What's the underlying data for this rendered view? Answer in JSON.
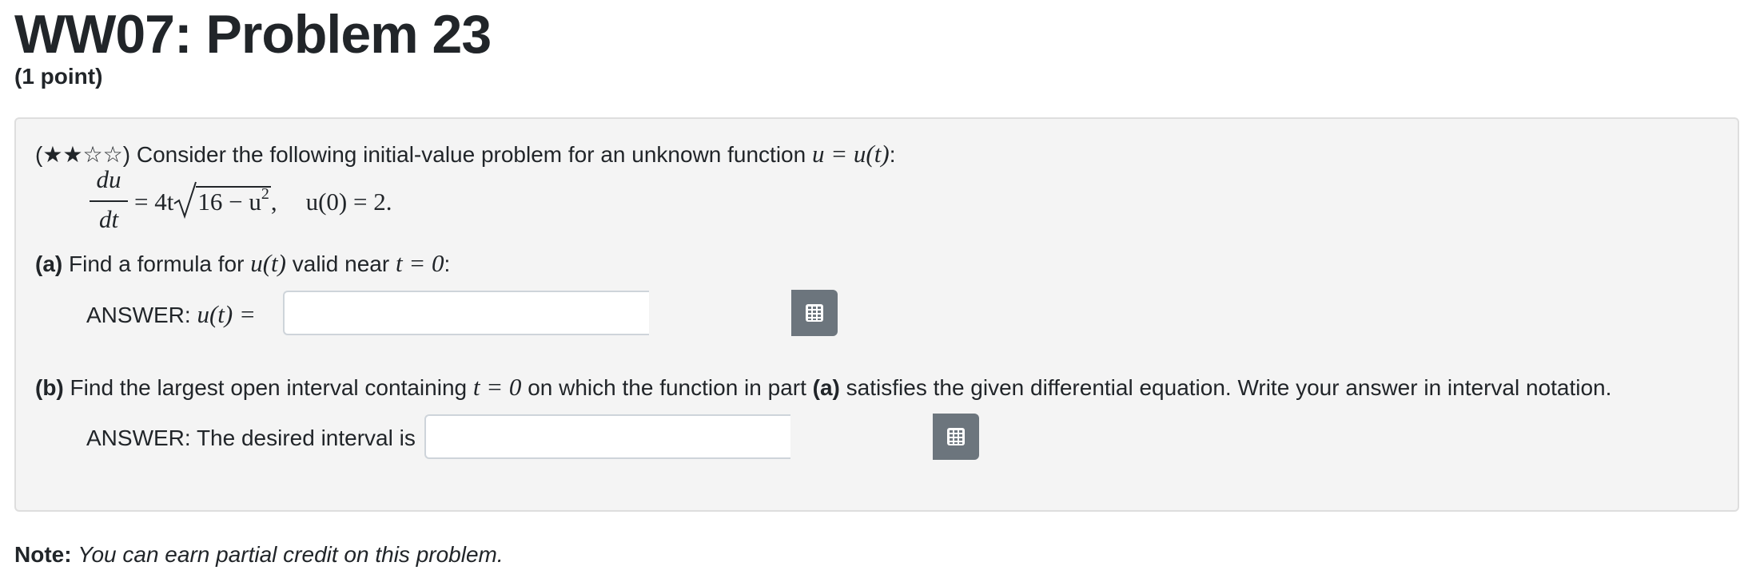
{
  "header": {
    "title": "WW07: Problem 23",
    "points": "(1 point)"
  },
  "problem": {
    "difficulty_stars": "★★☆☆",
    "intro_text": "Consider the following initial-value problem for an unknown function",
    "intro_math": "u = u(t)",
    "intro_end": ":",
    "ode": {
      "numerator": "du",
      "denominator": "dt",
      "rhs_lead": "= 4t",
      "radicand": "16 − u",
      "exponent": "2",
      "after_radical": ",",
      "initial_condition": "u(0) = 2."
    },
    "part_a": {
      "label": "(a)",
      "text_before": "Find a formula for",
      "math_1": "u(t)",
      "text_middle": "valid near",
      "math_2": "t = 0",
      "text_after": ":",
      "answer_prefix": "ANSWER:",
      "answer_math": "u(t) =",
      "input_value": ""
    },
    "part_b": {
      "label": "(b)",
      "text_before": "Find the largest open interval containing",
      "math_1": "t = 0",
      "text_middle": "on which the function in part",
      "bold_ref": "(a)",
      "text_after": "satisfies the given differential equation. Write your answer in interval notation.",
      "answer_label": "ANSWER: The desired interval is",
      "input_value": ""
    }
  },
  "footer": {
    "note_label": "Note:",
    "note_text": "You can earn partial credit on this problem."
  },
  "icons": {
    "palette_button_icon": "grid-palette-icon"
  },
  "colors": {
    "problem_background": "#f4f4f4",
    "button_gray": "#6c757d",
    "text": "#212529"
  }
}
